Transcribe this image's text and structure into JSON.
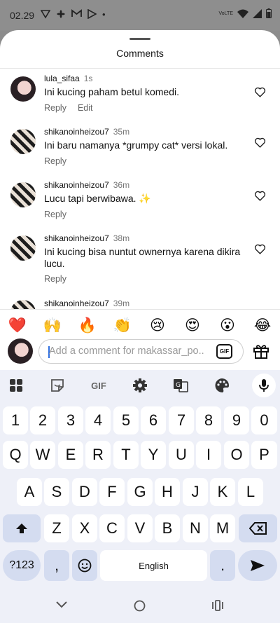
{
  "status_bar": {
    "time": "02.29",
    "volte_top": "VoLTE",
    "dot": "•"
  },
  "sheet": {
    "title": "Comments"
  },
  "comments": [
    {
      "user": "lula_sifaa",
      "time": "1s",
      "text": "Ini kucing paham betul komedi.",
      "reply": "Reply",
      "edit": "Edit"
    },
    {
      "user": "shikanoinheizou7",
      "time": "35m",
      "text": "Ini baru namanya *grumpy cat* versi lokal.",
      "reply": "Reply"
    },
    {
      "user": "shikanoinheizou7",
      "time": "36m",
      "text": "Lucu tapi berwibawa. ✨",
      "reply": "Reply"
    },
    {
      "user": "shikanoinheizou7",
      "time": "38m",
      "text": "Ini kucing bisa nuntut ownernya karena dikira lucu.",
      "reply": "Reply"
    },
    {
      "user": "shikanoinheizou7",
      "time": "39m"
    }
  ],
  "emojis": [
    "❤️",
    "🙌",
    "🔥",
    "👏",
    "😢",
    "😍",
    "😮",
    "😂"
  ],
  "compose": {
    "placeholder": "Add a comment for makassar_po...",
    "gif": "GIF"
  },
  "keyboard": {
    "toolbar": {
      "gif": "GIF"
    },
    "row_numbers": [
      "1",
      "2",
      "3",
      "4",
      "5",
      "6",
      "7",
      "8",
      "9",
      "0"
    ],
    "row1": [
      "Q",
      "W",
      "E",
      "R",
      "T",
      "Y",
      "U",
      "I",
      "O",
      "P"
    ],
    "row2": [
      "A",
      "S",
      "D",
      "F",
      "G",
      "H",
      "J",
      "K",
      "L"
    ],
    "row3": [
      "Z",
      "X",
      "C",
      "V",
      "B",
      "N",
      "M"
    ],
    "symbols": "?123",
    "comma": ",",
    "space": "English",
    "period": "."
  },
  "colors": {
    "accent": "#2f6fe0",
    "keyboard_bg": "#eef0f8",
    "key_dark": "#d4dcf0"
  }
}
